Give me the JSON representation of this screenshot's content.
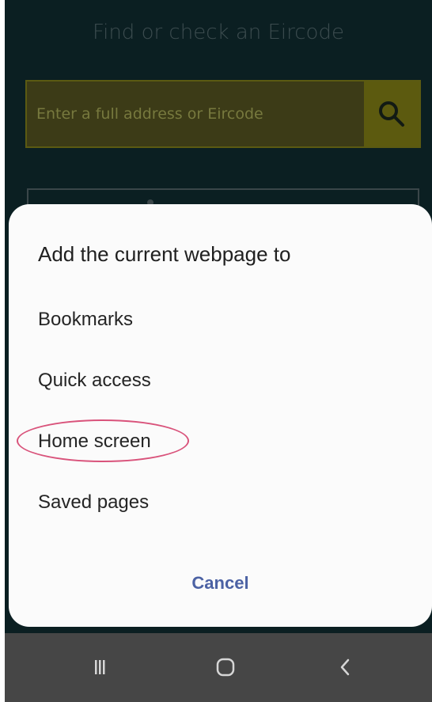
{
  "webpage": {
    "title": "Find or check an Eircode",
    "search_placeholder": "Enter a full address or Eircode",
    "search_icon": "search-icon"
  },
  "dialog": {
    "title": "Add the current webpage to",
    "items": [
      {
        "label": "Bookmarks"
      },
      {
        "label": "Quick access"
      },
      {
        "label": "Home screen",
        "highlighted": true
      },
      {
        "label": "Saved pages"
      }
    ],
    "cancel_label": "Cancel"
  },
  "navbar": {
    "buttons": [
      {
        "icon": "recents-icon"
      },
      {
        "icon": "home-icon"
      },
      {
        "icon": "back-icon"
      }
    ]
  },
  "colors": {
    "accent": "#4c62a4",
    "highlight": "#d9537b",
    "webpage_bg": "#0b1f22",
    "navbar_bg": "#464646"
  }
}
